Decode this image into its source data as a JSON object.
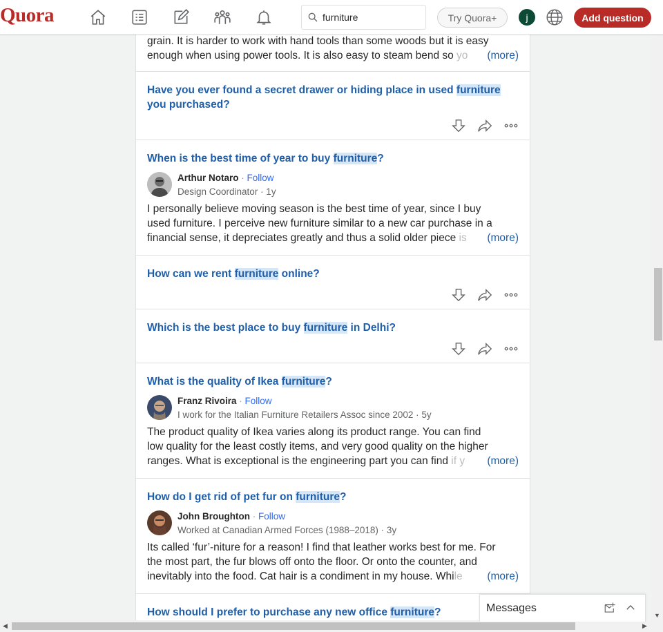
{
  "header": {
    "logo": "Quora",
    "search_value": "furniture",
    "try_label": "Try Quora+",
    "avatar_letter": "j",
    "add_question_label": "Add question"
  },
  "feed": {
    "top_answer": {
      "line1": "grain. It is harder to work with hand tools than some woods but it is easy",
      "line2": "enough when using power tools. It is also easy to steam bend so ",
      "fade": "yo",
      "more": "(more)"
    },
    "q1": {
      "before": "Have you ever found a secret drawer or hiding place in used ",
      "hl": "furniture",
      "after": " you purchased?"
    },
    "q2": {
      "before": "When is the best time of year to buy ",
      "hl": "furniture",
      "after": "?",
      "author": "Arthur Notaro",
      "follow": "Follow",
      "cred": "Design Coordinator · 1y",
      "line1": "I personally believe moving season is the best time of year, since I buy",
      "line2": "used furniture. I perceive new furniture similar to a new car purchase in a",
      "line3": "financial sense, it depreciates greatly and thus a solid older piece ",
      "fade": "is",
      "more": "(more)"
    },
    "q3": {
      "before": "How can we rent ",
      "hl": "furniture",
      "after": " online?"
    },
    "q4": {
      "before": "Which is the best place to buy ",
      "hl": "furniture",
      "after": " in Delhi?"
    },
    "q5": {
      "before": "What is the quality of Ikea ",
      "hl": "furniture",
      "after": "?",
      "author": "Franz Rivoira",
      "follow": "Follow",
      "cred": "I work for the Italian Furniture Retailers Assoc since 2002 · 5y",
      "line1": "The product quality of Ikea varies along its product range. You can find",
      "line2": "low quality for the least costly items, and very good quality on the higher",
      "line3": "ranges. What is exceptional is the engineering part you can find ",
      "fade": "if y",
      "more": "(more)"
    },
    "q6": {
      "before": "How do I get rid of pet fur on ",
      "hl": "furniture",
      "after": "?",
      "author": "John Broughton",
      "follow": "Follow",
      "cred": "Worked at Canadian Armed Forces (1988–2018) · 3y",
      "line1": "Its called ‘fur’-niture for a reason! I find that leather works best for me. For",
      "line2": "the most part, the fur blows off onto the floor. Or onto the counter, and",
      "line3": "inevitably into the food. Cat hair is a condiment in my house. Whi",
      "fade": "le",
      "more": "(more)"
    },
    "q7": {
      "before": "How should I prefer to purchase any new office ",
      "hl": "furniture",
      "after": "?"
    }
  },
  "messages": {
    "label": "Messages"
  },
  "icons": [
    "home-icon",
    "following-icon",
    "answer-icon",
    "spaces-icon",
    "notifications-icon",
    "search-icon",
    "globe-icon",
    "downvote-icon",
    "share-icon",
    "more-icon",
    "compose-message-icon",
    "chevron-up-icon"
  ]
}
